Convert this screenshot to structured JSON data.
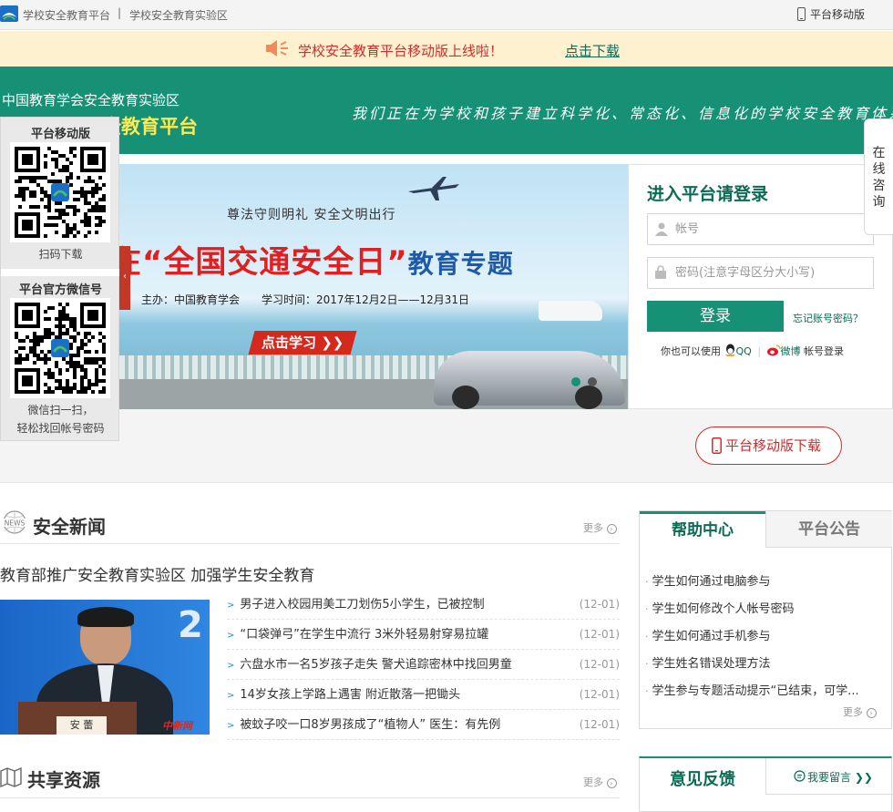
{
  "topbar": {
    "site_name": "学校安全教育平台",
    "separator": "|",
    "section": "学校安全教育实验区",
    "mobile_label": "平台移动版"
  },
  "notice": {
    "message": "学校安全教育平台移动版上线啦！",
    "download_link": "点击下载"
  },
  "header": {
    "org": "中国教育学会安全教育实验区",
    "platform_fragment": "全教育平台",
    "slogan": "我们正在为学校和孩子建立科学化、常态化、信息化的学校安全教育体系"
  },
  "side_panel": {
    "mobile_title": "平台移动版",
    "mobile_caption": "扫码下载",
    "wechat_title": "平台官方微信号",
    "wechat_caption_1": "微信扫一扫，",
    "wechat_caption_2": "轻松找回帐号密码",
    "collapse_arrow": "‹"
  },
  "banner": {
    "motto": "尊法守则明礼 安全文明出行",
    "title_red": "在“全国交通安全日”",
    "title_blue": "教育专题",
    "subtitle": "主办：中国教育学会　　学习时间：2017年12月2日——12月31日",
    "study_button": "点击学习 ❯❯"
  },
  "login": {
    "heading": "进入平台请登录",
    "account_placeholder": "帐号",
    "password_placeholder": "密码(注意字母区分大小写)",
    "login_button": "登录",
    "forgot_link": "忘记账号密码？",
    "alt_prefix": "你也可以使用",
    "qq_label": "QQ",
    "weibo_label": "微博",
    "alt_suffix": "帐号登录"
  },
  "consult": {
    "line1": "在",
    "line2": "线",
    "line3": "咨",
    "line4": "询"
  },
  "mobile_download_button": "平台移动版下载",
  "news": {
    "badge": "NEWS",
    "heading": "安全新闻",
    "more": "更多",
    "feature_title": "教育部推广安全教育实验区 加强学生安全教育",
    "photo_nameplate": "安 蕾",
    "photo_watermark": "中新网",
    "items": [
      {
        "title": "男子进入校园用美工刀划伤5小学生，已被控制",
        "date": "(12-01)"
      },
      {
        "title": "“口袋弹弓”在学生中流行 3米外轻易射穿易拉罐",
        "date": "(12-01)"
      },
      {
        "title": "六盘水市一名5岁孩子走失 警犬追踪密林中找回男童",
        "date": "(12-01)"
      },
      {
        "title": "14岁女孩上学路上遇害 附近散落一把锄头",
        "date": "(12-01)"
      },
      {
        "title": "被蚊子咬一口8岁男孩成了“植物人” 医生：有先例",
        "date": "(12-01)"
      }
    ]
  },
  "help": {
    "tab_active": "帮助中心",
    "tab_inactive": "平台公告",
    "more": "更多",
    "items": [
      "学生如何通过电脑参与",
      "学生如何修改个人帐号密码",
      "学生如何通过手机参与",
      "学生姓名错误处理方法",
      "学生参与专题活动提示“已结束，可学..."
    ]
  },
  "resources": {
    "heading": "共享资源",
    "more": "更多"
  },
  "feedback": {
    "heading": "意见反馈",
    "leave_message": "我要留言 ❯❯"
  },
  "colors": {
    "brand_green": "#169175",
    "dark_green": "#0b6b55",
    "accent_red": "#d42a2a",
    "notice_bg": "#fdf1cf"
  }
}
